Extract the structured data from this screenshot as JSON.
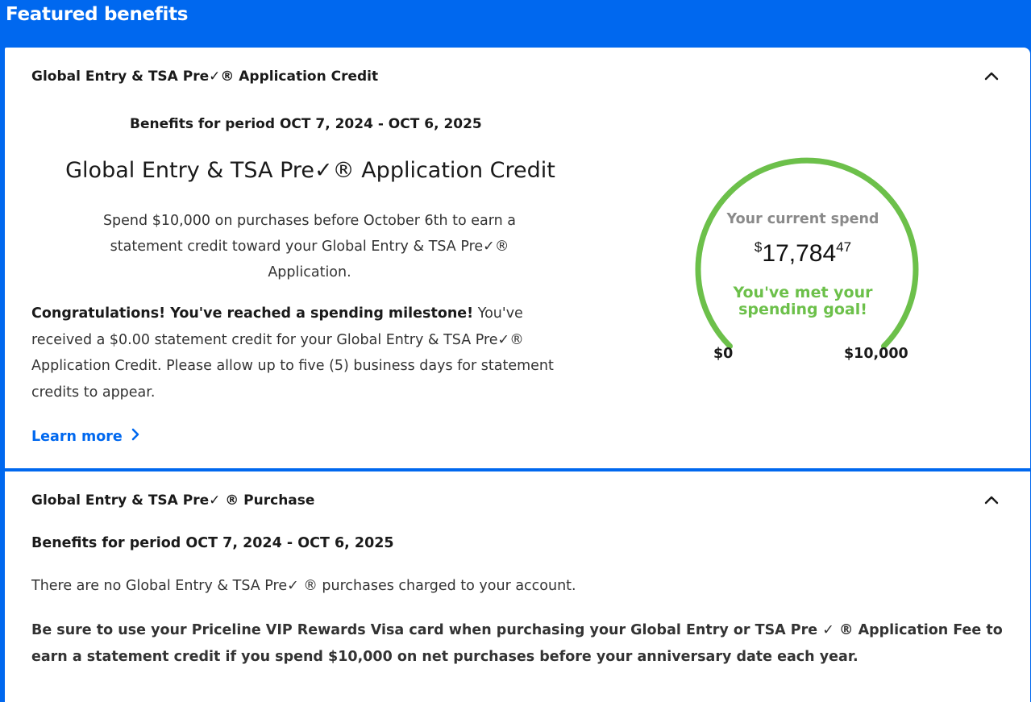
{
  "header": {
    "title": "Featured benefits"
  },
  "colors": {
    "brand_blue": "#0068ef",
    "goal_green": "#6cc04a",
    "gauge_grey": "#8a8a8a"
  },
  "application_credit": {
    "panel_title": "Global Entry & TSA Pre✓® Application Credit",
    "period": "Benefits for period OCT 7, 2024 - OCT 6, 2025",
    "title": "Global Entry & TSA Pre✓® Application Credit",
    "description": "Spend $10,000 on purchases before October 6th to earn a statement credit toward your Global Entry & TSA Pre✓® Application.",
    "congrats_bold": "Congratulations! You've reached a spending milestone!",
    "congrats_text": " You've received a $0.00 statement credit for your Global Entry & TSA Pre✓® Application Credit. Please allow up to five (5) business days for statement credits to appear.",
    "learn_more": "Learn more",
    "gauge": {
      "label": "Your current spend",
      "currency_symbol": "$",
      "amount_dollars": "17,784",
      "amount_cents": "47",
      "goal_message_line1": "You've met your",
      "goal_message_line2": "spending goal!",
      "min_label": "$0",
      "max_label": "$10,000",
      "progress_fraction": 1.0
    },
    "collapse_icon": "chevron-up-icon"
  },
  "purchase": {
    "panel_title": "Global Entry & TSA Pre✓ ® Purchase",
    "period": "Benefits for period OCT 7, 2024 - OCT 6, 2025",
    "no_purchases": "There are no Global Entry & TSA Pre✓ ® purchases charged to your account.",
    "note": "Be sure to use your Priceline VIP Rewards Visa card when purchasing your Global Entry or TSA Pre ✓ ® Application Fee to earn a statement credit if you spend $10,000 on net purchases before your anniversary date each year.",
    "collapse_icon": "chevron-up-icon"
  }
}
